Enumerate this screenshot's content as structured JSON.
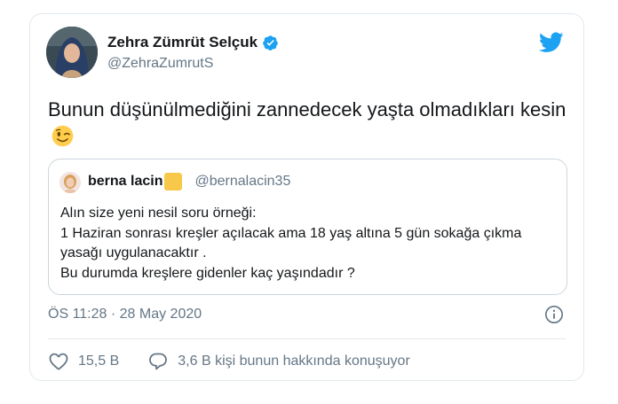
{
  "tweet": {
    "author_name": "Zehra Zümrüt Selçuk",
    "author_handle": "@ZehraZumrutS",
    "text": "Bunun düşünülmediğini zannedecek yaşta olmadıkları kesin",
    "timestamp": "ÖS 11:28 · 28 May 2020",
    "likes": "15,5 B",
    "replies_text": "3,6 B kişi bunun hakkında konuşuyor"
  },
  "quoted": {
    "author_name": "berna lacin",
    "author_handle": "@bernalacin35",
    "text": "Alın size yeni nesil soru örneği:\n1 Haziran sonrası kreşler açılacak ama 18 yaş altına  5 gün sokağa çıkma yasağı uygulanacaktır .\nBu durumda kreşlere gidenler kaç yaşındadır ?"
  },
  "icons": {
    "verified": "verified-badge-icon",
    "brand": "twitter-bird-icon",
    "emoji": "winking-face-emoji",
    "info": "info-icon",
    "like": "heart-icon",
    "reply": "speech-bubble-icon"
  },
  "colors": {
    "brand_blue": "#1da1f2",
    "secondary_text": "#657786",
    "border": "#e1e8ed",
    "quote_square": "#f8c84a"
  }
}
